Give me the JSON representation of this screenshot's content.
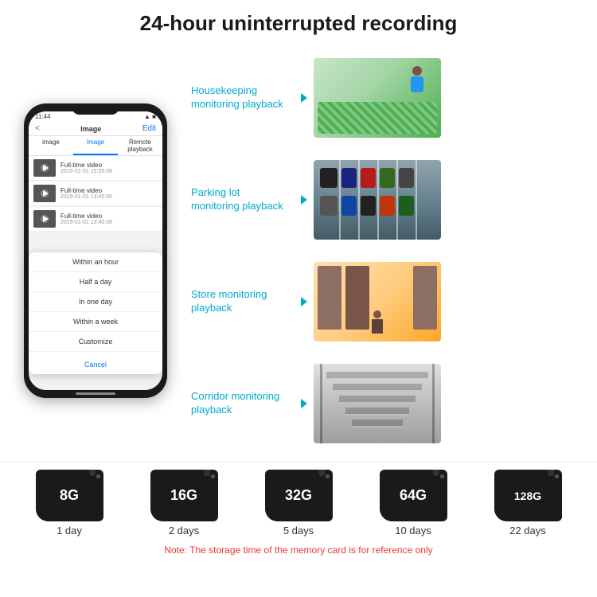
{
  "title": "24-hour uninterrupted recording",
  "phone": {
    "time": "11:44",
    "back": "<",
    "screen_title": "Image",
    "edit": "Edit",
    "tabs": [
      "image",
      "Image",
      "Remote playback"
    ],
    "active_tab": 1,
    "list_items": [
      {
        "title": "Full-time video",
        "date": "2019-01-01 15:55:08"
      },
      {
        "title": "Full-time video",
        "date": "2019-01-01 13:45:00"
      },
      {
        "title": "Full-time video",
        "date": "2019-01-01 13:40:08"
      }
    ],
    "dropdown_items": [
      "Within an hour",
      "Half a day",
      "In one day",
      "Within a week",
      "Customize"
    ],
    "cancel": "Cancel"
  },
  "monitoring": [
    {
      "label": "Housekeeping\nmonitoring playback",
      "img_type": "housekeeping"
    },
    {
      "label": "Parking lot\nmonitoring playback",
      "img_type": "parking"
    },
    {
      "label": "Store monitoring\nplayback",
      "img_type": "store"
    },
    {
      "label": "Corridor monitoring\nplayback",
      "img_type": "corridor"
    }
  ],
  "sdcards": [
    {
      "size": "8G",
      "days": "1 day"
    },
    {
      "size": "16G",
      "days": "2 days"
    },
    {
      "size": "32G",
      "days": "5 days"
    },
    {
      "size": "64G",
      "days": "10 days"
    },
    {
      "size": "128G",
      "days": "22 days"
    }
  ],
  "note": "Note: The storage time of the memory card is for reference only",
  "colors": {
    "accent": "#00aacc",
    "note_red": "#e53935"
  }
}
